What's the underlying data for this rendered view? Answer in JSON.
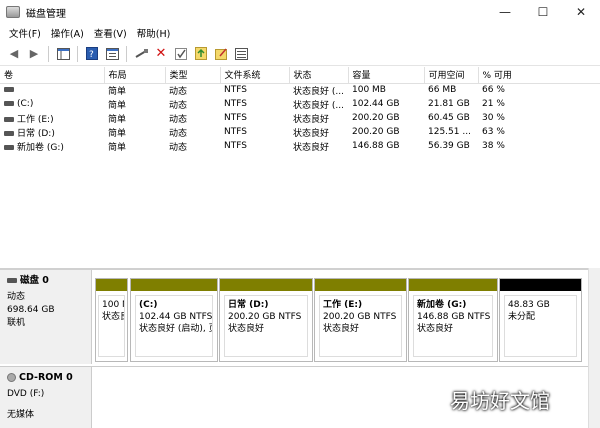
{
  "window": {
    "title": "磁盘管理",
    "minimize": "—",
    "maximize": "☐",
    "close": "✕"
  },
  "menu": [
    "文件(F)",
    "操作(A)",
    "查看(V)",
    "帮助(H)"
  ],
  "table": {
    "headers": [
      "卷",
      "布局",
      "类型",
      "文件系统",
      "状态",
      "容量",
      "可用空间",
      "% 可用"
    ],
    "rows": [
      [
        "",
        "简单",
        "动态",
        "NTFS",
        "状态良好 (...",
        "100 MB",
        "66 MB",
        "66 %"
      ],
      [
        "(C:)",
        "简单",
        "动态",
        "NTFS",
        "状态良好 (...",
        "102.44 GB",
        "21.81 GB",
        "21 %"
      ],
      [
        "工作 (E:)",
        "简单",
        "动态",
        "NTFS",
        "状态良好",
        "200.20 GB",
        "60.45 GB",
        "30 %"
      ],
      [
        "日常 (D:)",
        "简单",
        "动态",
        "NTFS",
        "状态良好",
        "200.20 GB",
        "125.51 ...",
        "63 %"
      ],
      [
        "新加卷 (G:)",
        "简单",
        "动态",
        "NTFS",
        "状态良好",
        "146.88 GB",
        "56.39 GB",
        "38 %"
      ]
    ]
  },
  "disk0": {
    "name": "磁盘 0",
    "type": "动态",
    "size": "698.64 GB",
    "status": "联机",
    "partitions": [
      {
        "name": "",
        "line1": "100 M",
        "line2": "状态良"
      },
      {
        "name": "(C:)",
        "line1": "102.44 GB NTFS",
        "line2": "状态良好 (启动), 页"
      },
      {
        "name": "日常 (D:)",
        "line1": "200.20 GB NTFS",
        "line2": "状态良好"
      },
      {
        "name": "工作 (E:)",
        "line1": "200.20 GB NTFS",
        "line2": "状态良好"
      },
      {
        "name": "新加卷 (G:)",
        "line1": "146.88 GB NTFS",
        "line2": "状态良好"
      },
      {
        "name": "",
        "line1": "48.83 GB",
        "line2": "未分配"
      }
    ]
  },
  "cdrom0": {
    "name": "CD-ROM 0",
    "type": "DVD (F:)",
    "status": "无媒体"
  },
  "watermark": "易坊好文馆",
  "toolbar_icons": [
    "back-icon",
    "forward-icon",
    "console-icon",
    "help-icon",
    "properties-icon",
    "connect-icon",
    "delete-icon",
    "check-icon",
    "import-icon",
    "folder-icon",
    "list-icon"
  ]
}
